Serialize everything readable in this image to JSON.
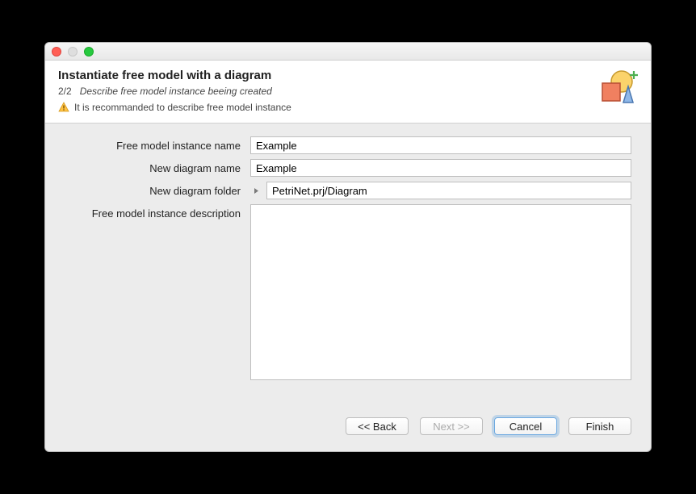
{
  "header": {
    "title": "Instantiate free model with a diagram",
    "step_number": "2/2",
    "step_description": "Describe free model instance beeing created",
    "info_text": "It is recommanded to describe free model instance"
  },
  "form": {
    "instance_name": {
      "label": "Free model instance name",
      "value": "Example"
    },
    "diagram_name": {
      "label": "New diagram name",
      "value": "Example"
    },
    "diagram_folder": {
      "label": "New diagram folder",
      "value": "PetriNet.prj/Diagram"
    },
    "description": {
      "label": "Free model instance description",
      "value": ""
    }
  },
  "buttons": {
    "back": "<< Back",
    "next": "Next >>",
    "cancel": "Cancel",
    "finish": "Finish"
  }
}
